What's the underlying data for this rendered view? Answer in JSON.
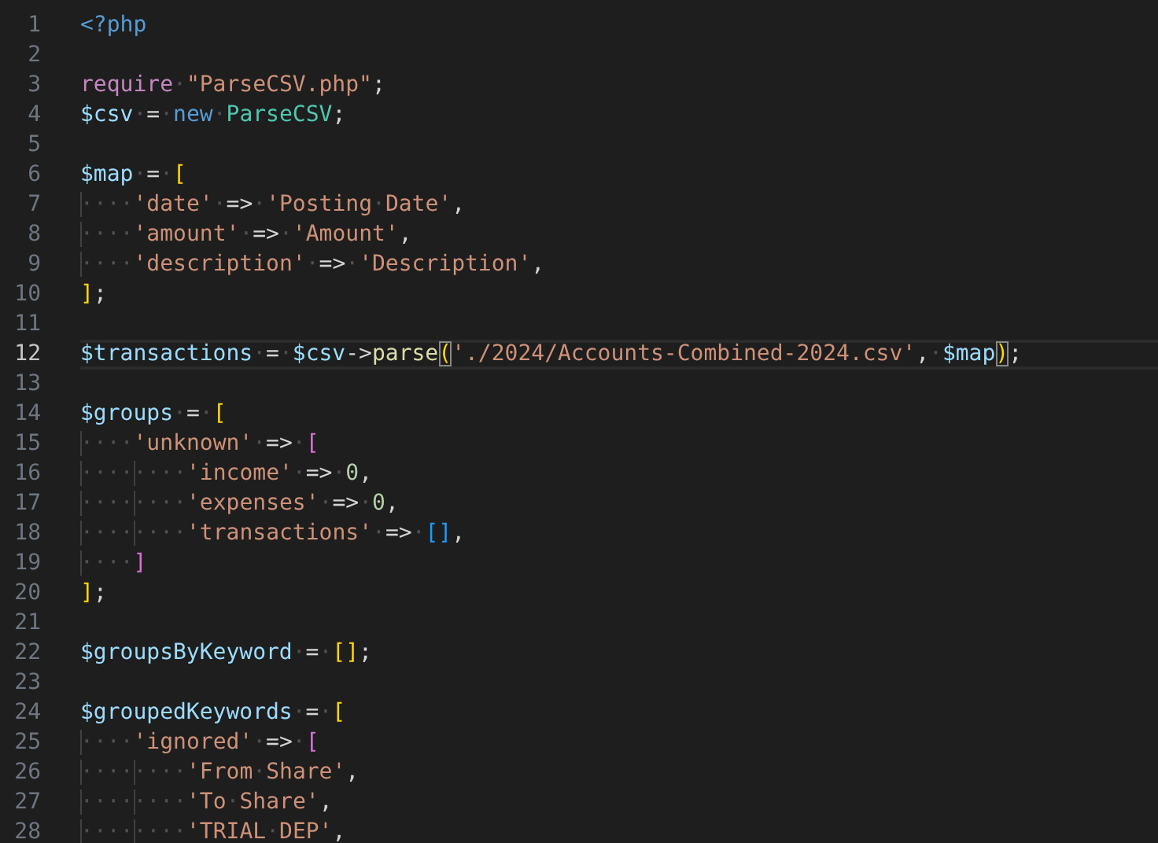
{
  "editor": {
    "lines": [
      {
        "number": "1",
        "active": false,
        "tokens": [
          {
            "kind": "tag",
            "text": "<?php"
          }
        ]
      },
      {
        "number": "2",
        "active": false
      },
      {
        "number": "3",
        "active": false,
        "tokens": [
          {
            "kind": "control",
            "text": "require"
          },
          {
            "kind": "plain",
            "text": "·"
          },
          {
            "kind": "string",
            "text": "\"ParseCSV.php\""
          },
          {
            "kind": "plain",
            "text": ";"
          }
        ]
      },
      {
        "number": "4",
        "active": false,
        "tokens": [
          {
            "kind": "variable",
            "text": "$csv"
          },
          {
            "kind": "plain",
            "text": "·=·"
          },
          {
            "kind": "keyword",
            "text": "new"
          },
          {
            "kind": "plain",
            "text": "·"
          },
          {
            "kind": "class",
            "text": "ParseCSV"
          },
          {
            "kind": "plain",
            "text": ";"
          }
        ]
      },
      {
        "number": "5",
        "active": false
      },
      {
        "number": "6",
        "active": false,
        "tokens": [
          {
            "kind": "variable",
            "text": "$map"
          },
          {
            "kind": "plain",
            "text": "·=·"
          },
          {
            "kind": "bracket1",
            "text": "["
          }
        ]
      },
      {
        "number": "7",
        "active": false,
        "tokens": [
          {
            "kind": "plain",
            "text": "····"
          },
          {
            "kind": "string",
            "text": "'date'"
          },
          {
            "kind": "plain",
            "text": "·=>·"
          },
          {
            "kind": "string",
            "text": "'Posting·Date'"
          },
          {
            "kind": "plain",
            "text": ","
          }
        ]
      },
      {
        "number": "8",
        "active": false,
        "tokens": [
          {
            "kind": "plain",
            "text": "····"
          },
          {
            "kind": "string",
            "text": "'amount'"
          },
          {
            "kind": "plain",
            "text": "·=>·"
          },
          {
            "kind": "string",
            "text": "'Amount'"
          },
          {
            "kind": "plain",
            "text": ","
          }
        ]
      },
      {
        "number": "9",
        "active": false,
        "tokens": [
          {
            "kind": "plain",
            "text": "····"
          },
          {
            "kind": "string",
            "text": "'description'"
          },
          {
            "kind": "plain",
            "text": "·=>·"
          },
          {
            "kind": "string",
            "text": "'Description'"
          },
          {
            "kind": "plain",
            "text": ","
          }
        ]
      },
      {
        "number": "10",
        "active": false,
        "tokens": [
          {
            "kind": "bracket1",
            "text": "]"
          },
          {
            "kind": "plain",
            "text": ";"
          }
        ]
      },
      {
        "number": "11",
        "active": false
      },
      {
        "number": "12",
        "active": true,
        "tokens": [
          {
            "kind": "variable",
            "text": "$transactions"
          },
          {
            "kind": "plain",
            "text": "·=·"
          },
          {
            "kind": "variable",
            "text": "$csv"
          },
          {
            "kind": "plain",
            "text": "->"
          },
          {
            "kind": "function",
            "text": "parse"
          },
          {
            "kind": "bracket1",
            "text": "(",
            "matched": true
          },
          {
            "kind": "string",
            "text": "'./2024/Accounts-Combined-2024.csv'"
          },
          {
            "kind": "plain",
            "text": ",·"
          },
          {
            "kind": "variable",
            "text": "$map"
          },
          {
            "kind": "bracket1",
            "text": ")",
            "matched": true
          },
          {
            "kind": "plain",
            "text": ";"
          }
        ]
      },
      {
        "number": "13",
        "active": false
      },
      {
        "number": "14",
        "active": false,
        "tokens": [
          {
            "kind": "variable",
            "text": "$groups"
          },
          {
            "kind": "plain",
            "text": "·=·"
          },
          {
            "kind": "bracket1",
            "text": "["
          }
        ]
      },
      {
        "number": "15",
        "active": false,
        "tokens": [
          {
            "kind": "plain",
            "text": "····"
          },
          {
            "kind": "string",
            "text": "'unknown'"
          },
          {
            "kind": "plain",
            "text": "·=>·"
          },
          {
            "kind": "bracket2",
            "text": "["
          }
        ]
      },
      {
        "number": "16",
        "active": false,
        "tokens": [
          {
            "kind": "plain",
            "text": "········"
          },
          {
            "kind": "string",
            "text": "'income'"
          },
          {
            "kind": "plain",
            "text": "·=>·"
          },
          {
            "kind": "number",
            "text": "0"
          },
          {
            "kind": "plain",
            "text": ","
          }
        ]
      },
      {
        "number": "17",
        "active": false,
        "tokens": [
          {
            "kind": "plain",
            "text": "········"
          },
          {
            "kind": "string",
            "text": "'expenses'"
          },
          {
            "kind": "plain",
            "text": "·=>·"
          },
          {
            "kind": "number",
            "text": "0"
          },
          {
            "kind": "plain",
            "text": ","
          }
        ]
      },
      {
        "number": "18",
        "active": false,
        "tokens": [
          {
            "kind": "plain",
            "text": "········"
          },
          {
            "kind": "string",
            "text": "'transactions'"
          },
          {
            "kind": "plain",
            "text": "·=>·"
          },
          {
            "kind": "bracket3",
            "text": "[]"
          },
          {
            "kind": "plain",
            "text": ","
          }
        ]
      },
      {
        "number": "19",
        "active": false,
        "tokens": [
          {
            "kind": "plain",
            "text": "····"
          },
          {
            "kind": "bracket2",
            "text": "]"
          }
        ]
      },
      {
        "number": "20",
        "active": false,
        "tokens": [
          {
            "kind": "bracket1",
            "text": "]"
          },
          {
            "kind": "plain",
            "text": ";"
          }
        ]
      },
      {
        "number": "21",
        "active": false
      },
      {
        "number": "22",
        "active": false,
        "tokens": [
          {
            "kind": "variable",
            "text": "$groupsByKeyword"
          },
          {
            "kind": "plain",
            "text": "·=·"
          },
          {
            "kind": "bracket1",
            "text": "[]"
          },
          {
            "kind": "plain",
            "text": ";"
          }
        ]
      },
      {
        "number": "23",
        "active": false
      },
      {
        "number": "24",
        "active": false,
        "tokens": [
          {
            "kind": "variable",
            "text": "$groupedKeywords"
          },
          {
            "kind": "plain",
            "text": "·=·"
          },
          {
            "kind": "bracket1",
            "text": "["
          }
        ]
      },
      {
        "number": "25",
        "active": false,
        "tokens": [
          {
            "kind": "plain",
            "text": "····"
          },
          {
            "kind": "string",
            "text": "'ignored'"
          },
          {
            "kind": "plain",
            "text": "·=>·"
          },
          {
            "kind": "bracket2",
            "text": "["
          }
        ]
      },
      {
        "number": "26",
        "active": false,
        "tokens": [
          {
            "kind": "plain",
            "text": "········"
          },
          {
            "kind": "string",
            "text": "'From·Share'"
          },
          {
            "kind": "plain",
            "text": ","
          }
        ]
      },
      {
        "number": "27",
        "active": false,
        "tokens": [
          {
            "kind": "plain",
            "text": "········"
          },
          {
            "kind": "string",
            "text": "'To·Share'"
          },
          {
            "kind": "plain",
            "text": ","
          }
        ]
      },
      {
        "number": "28",
        "active": false,
        "tokens": [
          {
            "kind": "plain",
            "text": "········"
          },
          {
            "kind": "string",
            "text": "'TRIAL·DEP'"
          },
          {
            "kind": "plain",
            "text": ","
          }
        ]
      }
    ]
  }
}
